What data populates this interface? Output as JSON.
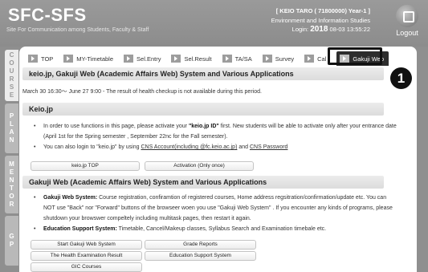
{
  "header": {
    "logo": "SFC-SFS",
    "tagline": "Site For Communication among Students, Faculty & Staff",
    "user_name": "[ KEIO TARO ( 71800000) Year-1 ]",
    "department": "Environment and Information Studies",
    "login_label": "Login:",
    "login_date": "2018",
    "login_time": "08-03 13:55:22",
    "logout_label": "Logout"
  },
  "side_tabs": [
    {
      "label": "COURSE"
    },
    {
      "label": "PLAN"
    },
    {
      "label": "MENTOR"
    },
    {
      "label": "GP"
    }
  ],
  "tabs": [
    {
      "label": "TOP"
    },
    {
      "label": "MY-Timetable"
    },
    {
      "label": "Sel.Entry"
    },
    {
      "label": "Sel.Result"
    },
    {
      "label": "TA/SA"
    },
    {
      "label": "Survey"
    },
    {
      "label": "Cal"
    },
    {
      "label": "Gakuji Web"
    }
  ],
  "badge": "1",
  "page_title": "keio.jp, Gakuji Web (Academic Affairs Web) System and Various Applications",
  "notice": "March 30 16:30〜 June 27 9:00 - The result of health checkup is not available during this period.",
  "keio_section": {
    "title": "Keio.jp",
    "bullet1_pre": "In order to use functions in this page, please activate your ",
    "bullet1_bold": "\"keio.jp ID\"",
    "bullet1_post": " first. New students will be able to activate only after your entrance date (April 1st for the Spring semester , September 22nc for the Fall semester).",
    "bullet2_pre": "You can also login to \"keio.jp\" by using ",
    "bullet2_link1": "CNS Account(including @fc.keio.ac.jp)",
    "bullet2_mid": " and ",
    "bullet2_link2": "CNS Password",
    "buttons": [
      "keio.jp TOP",
      "Activation (Only once)"
    ]
  },
  "gakuji_section": {
    "title": "Gakuji Web (Academic Affairs Web) System and Various Applications",
    "bullet1_bold": "Gakuji Web System:",
    "bullet1_text": " Course registration, confiramtion of registered courses, Home address regsitration/confirmation/update etc. You can NOT use \"Back\" nor \"Forward\" buttons of the browseer woen you use \"Gakuji Web System\" . If you encounter any kinds of programs, please shutdown your browswer compeltely including multitask pages, then restart it again.",
    "bullet2_bold": "Education Support System:",
    "bullet2_text": " Timetable, Cancel/Makeup classes, Syllabus Search and Examination timebale etc.",
    "buttons": [
      "Start Gakuji Web System",
      "Grade Reports",
      "The Health Examination Result",
      "Education Support System",
      "GIC Courses"
    ]
  }
}
